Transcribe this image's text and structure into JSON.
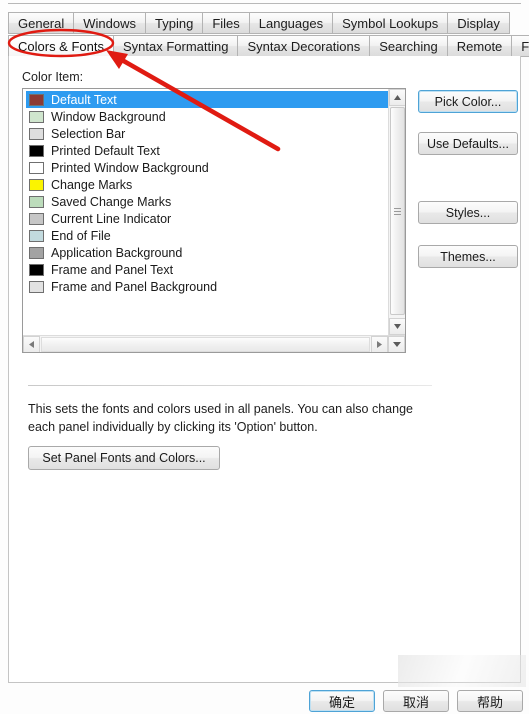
{
  "dialog": {
    "tabs_row1": [
      {
        "label": "General",
        "active": false
      },
      {
        "label": "Windows",
        "active": false
      },
      {
        "label": "Typing",
        "active": false
      },
      {
        "label": "Files",
        "active": false
      },
      {
        "label": "Languages",
        "active": false
      },
      {
        "label": "Symbol Lookups",
        "active": false
      },
      {
        "label": "Display",
        "active": false
      }
    ],
    "tabs_row2": [
      {
        "label": "Colors & Fonts",
        "active": true
      },
      {
        "label": "Syntax Formatting",
        "active": false
      },
      {
        "label": "Syntax Decorations",
        "active": false
      },
      {
        "label": "Searching",
        "active": false
      },
      {
        "label": "Remote",
        "active": false
      },
      {
        "label": "Folders",
        "active": false
      }
    ],
    "color_item_label": "Color Item:",
    "color_items": [
      {
        "label": "Default Text",
        "swatch": "#8c3a34",
        "selected": true
      },
      {
        "label": "Window Background",
        "swatch": "#cfe5cd",
        "selected": false
      },
      {
        "label": "Selection Bar",
        "swatch": "#dedede",
        "selected": false
      },
      {
        "label": "Printed Default Text",
        "swatch": "#000000",
        "selected": false
      },
      {
        "label": "Printed Window Background",
        "swatch": "#ffffff",
        "selected": false
      },
      {
        "label": "Change Marks",
        "swatch": "#fbf400",
        "selected": false
      },
      {
        "label": "Saved Change Marks",
        "swatch": "#bcdcbb",
        "selected": false
      },
      {
        "label": "Current Line Indicator",
        "swatch": "#c6c6c6",
        "selected": false
      },
      {
        "label": "End of File",
        "swatch": "#c2dade",
        "selected": false
      },
      {
        "label": "Application Background",
        "swatch": "#a3a3a3",
        "selected": false
      },
      {
        "label": "Frame and Panel Text",
        "swatch": "#000000",
        "selected": false
      },
      {
        "label": "Frame and Panel Background",
        "swatch": "#e2e2e2",
        "selected": false
      }
    ],
    "buttons": {
      "pick_color": "Pick Color...",
      "use_defaults": "Use Defaults...",
      "styles": "Styles...",
      "themes": "Themes...",
      "set_panel": "Set Panel Fonts and Colors..."
    },
    "description_line1": "This sets the fonts and colors used in all panels. You can also change",
    "description_line2": "each panel individually by clicking its 'Option' button.",
    "footer": {
      "ok": "确定",
      "cancel": "取消",
      "help": "帮助"
    }
  },
  "annotation": {
    "color": "#e01b12",
    "ellipse_target": "Colors & Fonts",
    "arrow_description": "red arrow pointing to Colors & Fonts tab"
  },
  "icons": {
    "scroll_up": "triangle-up",
    "scroll_down": "triangle-down",
    "scroll_left": "triangle-left",
    "scroll_right": "triangle-right"
  }
}
